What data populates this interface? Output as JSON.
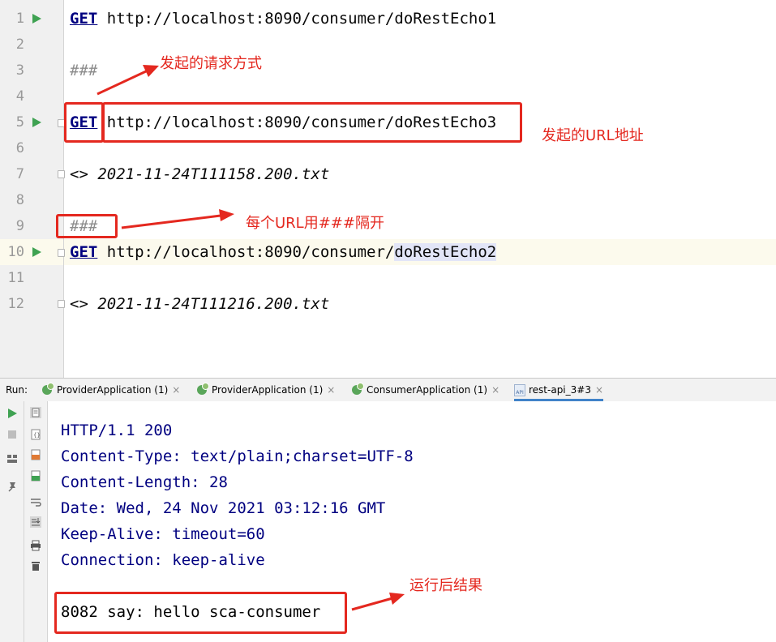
{
  "editor": {
    "line_numbers": [
      "1",
      "2",
      "3",
      "4",
      "5",
      "6",
      "7",
      "8",
      "9",
      "10",
      "11",
      "12"
    ],
    "lines": {
      "l1": {
        "method": "GET",
        "url": " http://localhost:8090/consumer/doRestEcho1"
      },
      "l3": {
        "comment": "###"
      },
      "l5": {
        "method": "GET",
        "url": " http://localhost:8090/consumer/doRestEcho3"
      },
      "l7": {
        "prefix": "<> ",
        "file": "2021-11-24T111158.200.txt"
      },
      "l9": {
        "comment": "###"
      },
      "l10": {
        "method": "GET",
        "url_base": " http://localhost:8090/consumer/",
        "url_tail": "doRestEcho2"
      },
      "l12": {
        "prefix": "<> ",
        "file": "2021-11-24T111216.200.txt"
      }
    }
  },
  "annotations": {
    "request_method": "发起的请求方式",
    "request_url": "发起的URL地址",
    "separator": "每个URL用###隔开",
    "result": "运行后结果"
  },
  "run_panel": {
    "label": "Run:",
    "tabs": [
      {
        "label": "ProviderApplication (1)",
        "close": "×"
      },
      {
        "label": "ProviderApplication (1)",
        "close": "×"
      },
      {
        "label": "ConsumerApplication (1)",
        "close": "×"
      },
      {
        "label": "rest-api_3#3",
        "close": "×",
        "active": true
      }
    ],
    "console_lines": [
      "HTTP/1.1 200",
      "Content-Type: text/plain;charset=UTF-8",
      "Content-Length: 28",
      "Date: Wed, 24 Nov 2021 03:12:16 GMT",
      "Keep-Alive: timeout=60",
      "Connection: keep-alive"
    ],
    "result_line": "8082 say: hello sca-consumer"
  },
  "colors": {
    "annotation": "#e4281f",
    "keyword": "#000080",
    "run_arrow": "#3fa252",
    "current_line": "#fcfaed"
  }
}
